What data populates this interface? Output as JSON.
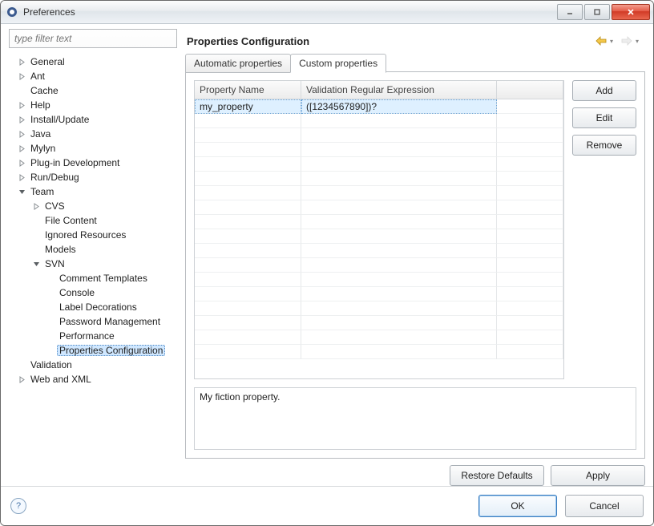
{
  "window": {
    "title": "Preferences"
  },
  "filter": {
    "placeholder": "type filter text"
  },
  "tree": [
    {
      "label": "General",
      "expandable": true,
      "expanded": false,
      "depth": 0
    },
    {
      "label": "Ant",
      "expandable": true,
      "expanded": false,
      "depth": 0
    },
    {
      "label": "Cache",
      "expandable": false,
      "depth": 0
    },
    {
      "label": "Help",
      "expandable": true,
      "expanded": false,
      "depth": 0
    },
    {
      "label": "Install/Update",
      "expandable": true,
      "expanded": false,
      "depth": 0
    },
    {
      "label": "Java",
      "expandable": true,
      "expanded": false,
      "depth": 0
    },
    {
      "label": "Mylyn",
      "expandable": true,
      "expanded": false,
      "depth": 0
    },
    {
      "label": "Plug-in Development",
      "expandable": true,
      "expanded": false,
      "depth": 0
    },
    {
      "label": "Run/Debug",
      "expandable": true,
      "expanded": false,
      "depth": 0
    },
    {
      "label": "Team",
      "expandable": true,
      "expanded": true,
      "depth": 0
    },
    {
      "label": "CVS",
      "expandable": true,
      "expanded": false,
      "depth": 1
    },
    {
      "label": "File Content",
      "expandable": false,
      "depth": 1
    },
    {
      "label": "Ignored Resources",
      "expandable": false,
      "depth": 1
    },
    {
      "label": "Models",
      "expandable": false,
      "depth": 1
    },
    {
      "label": "SVN",
      "expandable": true,
      "expanded": true,
      "depth": 1
    },
    {
      "label": "Comment Templates",
      "expandable": false,
      "depth": 2
    },
    {
      "label": "Console",
      "expandable": false,
      "depth": 2
    },
    {
      "label": "Label Decorations",
      "expandable": false,
      "depth": 2
    },
    {
      "label": "Password Management",
      "expandable": false,
      "depth": 2
    },
    {
      "label": "Performance",
      "expandable": false,
      "depth": 2
    },
    {
      "label": "Properties Configuration",
      "expandable": false,
      "depth": 2,
      "selected": true
    },
    {
      "label": "Validation",
      "expandable": false,
      "depth": 0
    },
    {
      "label": "Web and XML",
      "expandable": true,
      "expanded": false,
      "depth": 0
    }
  ],
  "page": {
    "title": "Properties Configuration"
  },
  "tabs": {
    "0": {
      "label": "Automatic properties"
    },
    "1": {
      "label": "Custom properties"
    }
  },
  "table": {
    "headers": {
      "name": "Property Name",
      "regex": "Validation Regular Expression"
    },
    "rows": {
      "0": {
        "name": "my_property",
        "regex": "([1234567890])?"
      }
    }
  },
  "buttons": {
    "add": "Add",
    "edit": "Edit",
    "remove": "Remove",
    "restore": "Restore Defaults",
    "apply": "Apply",
    "ok": "OK",
    "cancel": "Cancel"
  },
  "description": "My fiction property."
}
